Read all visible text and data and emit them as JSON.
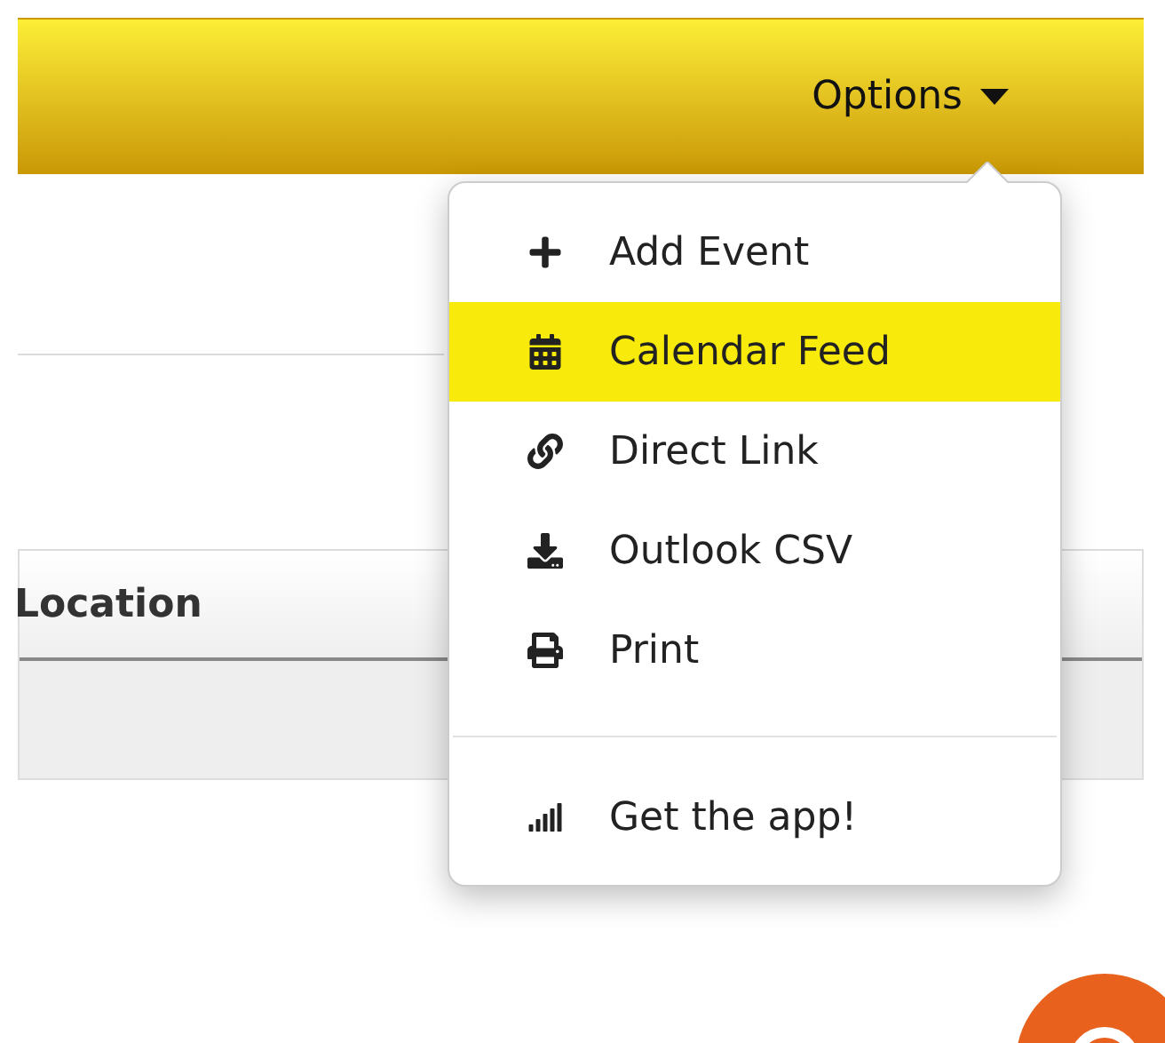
{
  "header": {
    "options_button": {
      "label": "Options",
      "expanded": true
    }
  },
  "menu": {
    "items": [
      {
        "label": "Add Event",
        "selected": false
      },
      {
        "label": "Calendar Feed",
        "selected": true
      },
      {
        "label": "Direct Link",
        "selected": false
      },
      {
        "label": "Outlook CSV",
        "selected": false
      },
      {
        "label": "Print",
        "selected": false
      }
    ],
    "footer_items": [
      {
        "label": "Get the app!",
        "selected": false
      }
    ]
  },
  "table": {
    "columns": [
      "Location"
    ]
  }
}
